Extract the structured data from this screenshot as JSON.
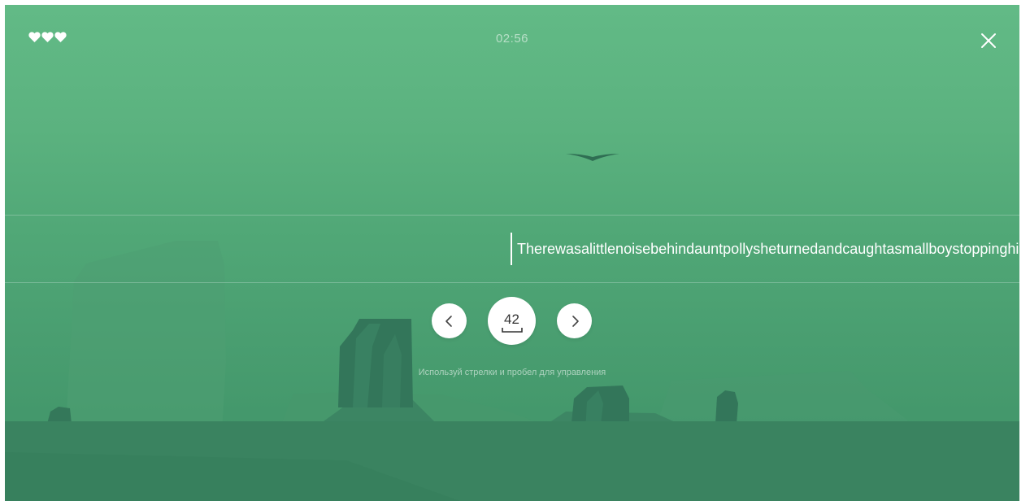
{
  "game": {
    "lives": 3,
    "timer": "02:56",
    "text": "Therewasalittlenoisebehindauntpollysheturnedandcaughtasmallboystoppinghimb",
    "speed": "42",
    "hint": "Используй стрелки и пробел для управления"
  },
  "icons": {
    "life": "heart-icon",
    "close": "close-icon",
    "prev": "chevron-left-icon",
    "next": "chevron-right-icon",
    "space": "spacebar-icon"
  },
  "colors": {
    "sky_top": "#62ba86",
    "sky_bottom": "#3f9168",
    "rock": "#33765a",
    "ground": "#3a8360",
    "text": "#ffffff"
  }
}
